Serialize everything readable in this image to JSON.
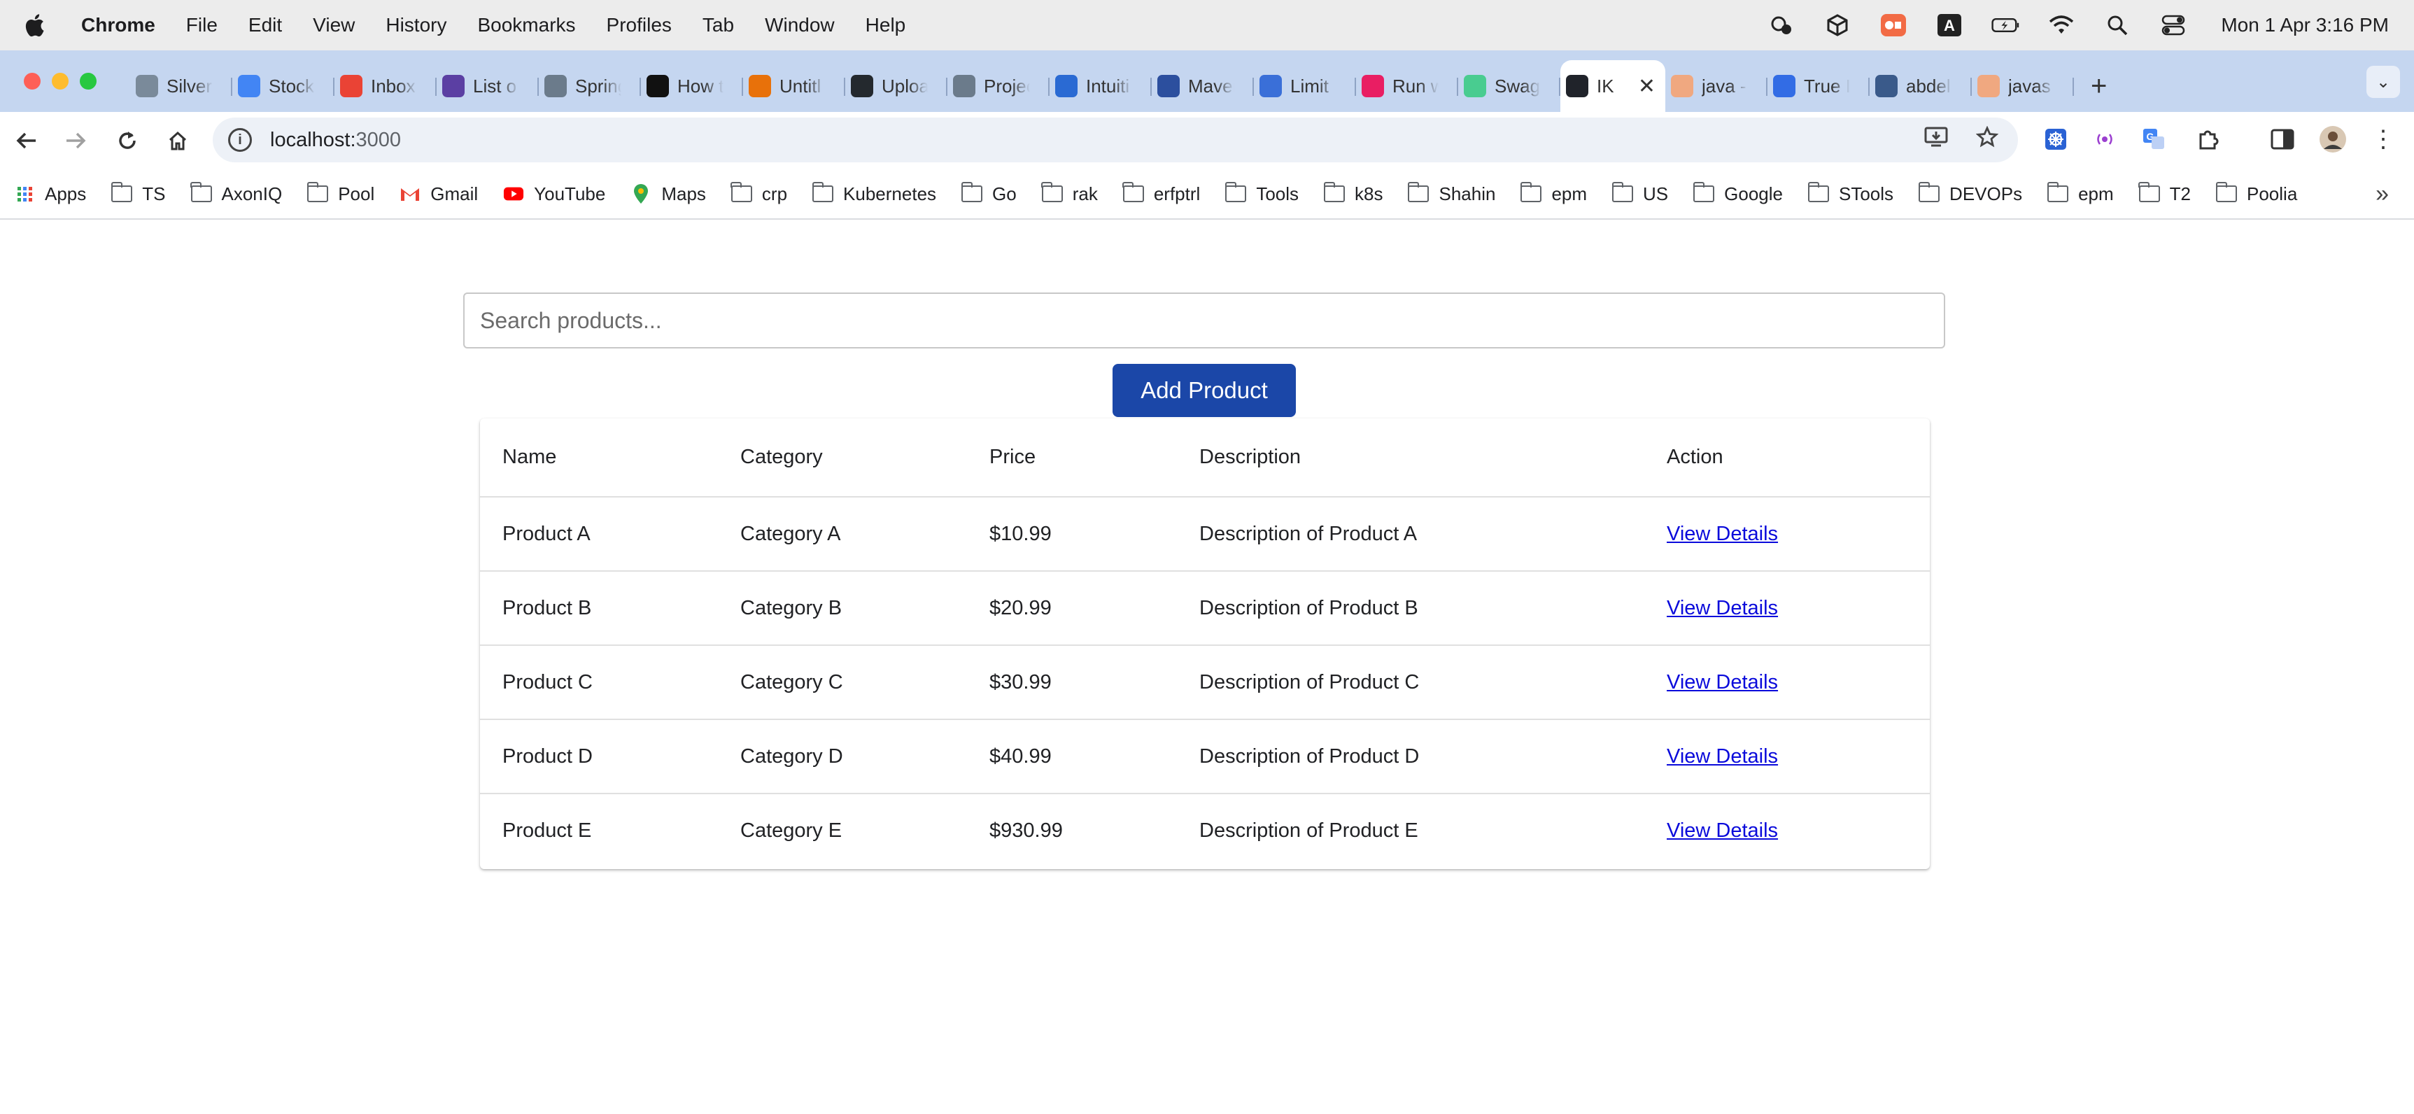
{
  "menubar": {
    "app_name": "Chrome",
    "items": [
      "File",
      "Edit",
      "View",
      "History",
      "Bookmarks",
      "Profiles",
      "Tab",
      "Window",
      "Help"
    ],
    "clock": "Mon 1 Apr  3:16 PM"
  },
  "tabs": [
    {
      "title": "Silver",
      "color": "#7a8a9a"
    },
    {
      "title": "Stock",
      "color": "#4285f4"
    },
    {
      "title": "Inbox",
      "color": "#ea4335"
    },
    {
      "title": "List o",
      "color": "#5b3fa3"
    },
    {
      "title": "Spring",
      "color": "#6b7b8b"
    },
    {
      "title": "How t",
      "color": "#111111"
    },
    {
      "title": "Untitl",
      "color": "#e8710a"
    },
    {
      "title": "Uploa",
      "color": "#24292e"
    },
    {
      "title": "Projec",
      "color": "#6b7b8b"
    },
    {
      "title": "Intuiti",
      "color": "#2a6ad3"
    },
    {
      "title": "Maven",
      "color": "#2c4f9e"
    },
    {
      "title": "Limit",
      "color": "#3a6fd8"
    },
    {
      "title": "Run w",
      "color": "#e91e63"
    },
    {
      "title": "Swagg",
      "color": "#49cc90"
    },
    {
      "title": "IK",
      "color": "#20232a",
      "active": true
    },
    {
      "title": "java -",
      "color": "#f0a880"
    },
    {
      "title": "True I",
      "color": "#326ce5"
    },
    {
      "title": "abdel",
      "color": "#3a5a8a"
    },
    {
      "title": "javas",
      "color": "#f0a880"
    }
  ],
  "address_bar": {
    "host": "localhost:",
    "port": "3000"
  },
  "bookmarks": [
    {
      "label": "Apps",
      "icon": "apps-grid"
    },
    {
      "label": "TS",
      "icon": "folder"
    },
    {
      "label": "AxonIQ",
      "icon": "folder"
    },
    {
      "label": "Pool",
      "icon": "folder"
    },
    {
      "label": "Gmail",
      "icon": "gmail"
    },
    {
      "label": "YouTube",
      "icon": "youtube"
    },
    {
      "label": "Maps",
      "icon": "maps"
    },
    {
      "label": "crp",
      "icon": "folder"
    },
    {
      "label": "Kubernetes",
      "icon": "folder"
    },
    {
      "label": "Go",
      "icon": "folder"
    },
    {
      "label": "rak",
      "icon": "folder"
    },
    {
      "label": "erfptrl",
      "icon": "folder"
    },
    {
      "label": "Tools",
      "icon": "folder"
    },
    {
      "label": "k8s",
      "icon": "folder"
    },
    {
      "label": "Shahin",
      "icon": "folder"
    },
    {
      "label": "epm",
      "icon": "folder"
    },
    {
      "label": "US",
      "icon": "folder"
    },
    {
      "label": "Google",
      "icon": "folder"
    },
    {
      "label": "STools",
      "icon": "folder"
    },
    {
      "label": "DEVOPs",
      "icon": "folder"
    },
    {
      "label": "epm",
      "icon": "folder"
    },
    {
      "label": "T2",
      "icon": "folder"
    },
    {
      "label": "Poolia",
      "icon": "folder"
    }
  ],
  "search": {
    "placeholder": "Search products..."
  },
  "add_button": "Add Product",
  "table": {
    "headers": [
      "Name",
      "Category",
      "Price",
      "Description",
      "Action"
    ],
    "rows": [
      {
        "name": "Product A",
        "category": "Category A",
        "price": "$10.99",
        "description": "Description of Product A",
        "action": "View Details"
      },
      {
        "name": "Product B",
        "category": "Category B",
        "price": "$20.99",
        "description": "Description of Product B",
        "action": "View Details"
      },
      {
        "name": "Product C",
        "category": "Category C",
        "price": "$30.99",
        "description": "Description of Product C",
        "action": "View Details"
      },
      {
        "name": "Product D",
        "category": "Category D",
        "price": "$40.99",
        "description": "Description of Product D",
        "action": "View Details"
      },
      {
        "name": "Product E",
        "category": "Category E",
        "price": "$930.99",
        "description": "Description of Product E",
        "action": "View Details"
      }
    ]
  },
  "colors": {
    "primary_button": "#1b47a8",
    "link": "#0a0adb",
    "tab_strip": "#c5d6f0"
  }
}
